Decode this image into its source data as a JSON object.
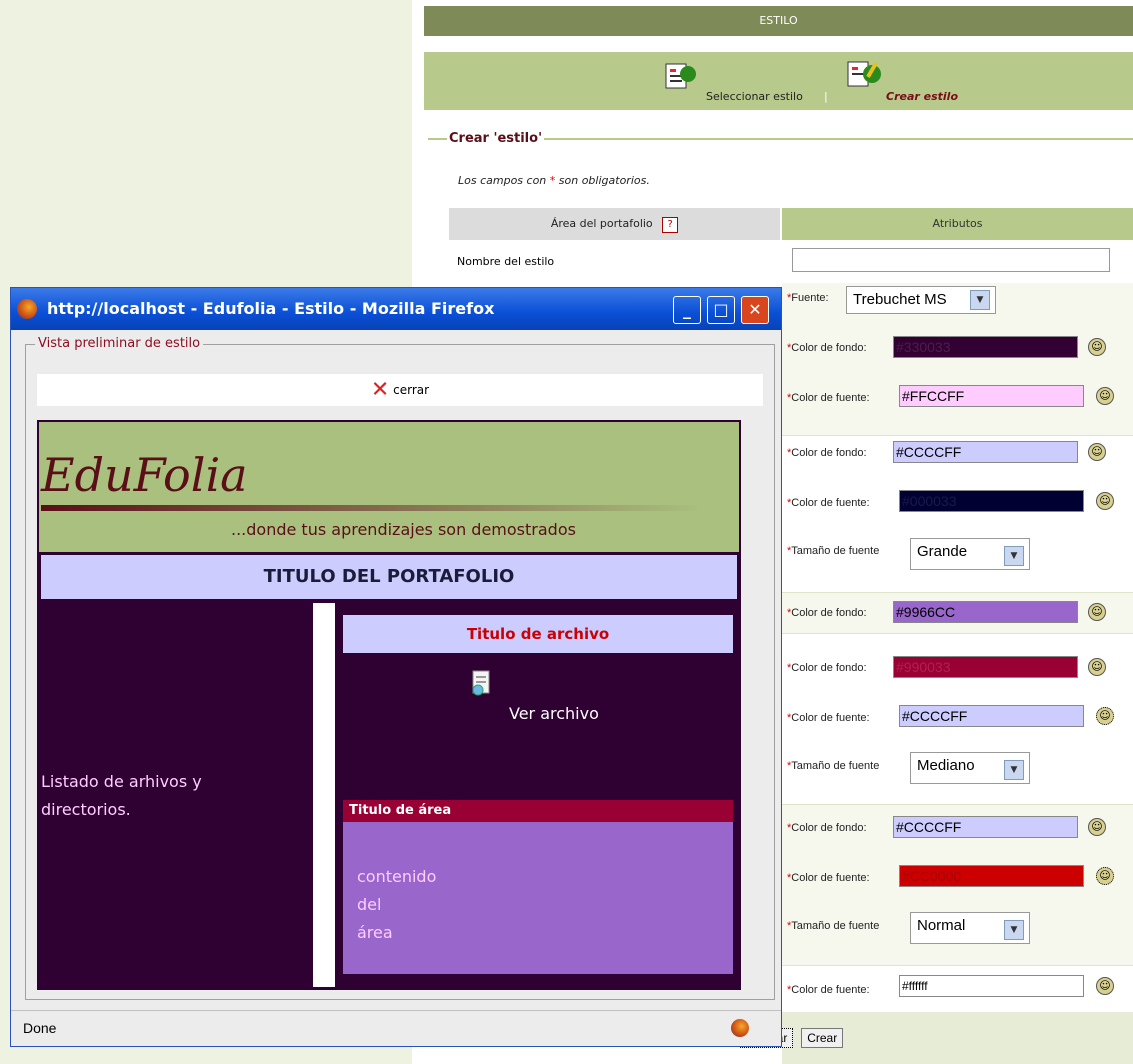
{
  "header": {
    "title": "ESTILO"
  },
  "nav": {
    "select_label": "Seleccionar estilo",
    "separator": "|",
    "create_label": "Crear estilo"
  },
  "form": {
    "legend": "Crear 'estilo'",
    "required_prefix": "Los campos con ",
    "required_star": "*",
    "required_suffix": " son obligatorios.",
    "col_area": "Área del portafolio",
    "col_attr": "Atributos",
    "name_label": "Nombre del estilo",
    "name_value": ""
  },
  "attributes": {
    "font_label": "Fuente:",
    "font_value": "Trebuchet MS",
    "bg_label": "Color de fondo:",
    "fg_label": "Color de fuente:",
    "size_label": "Tamaño de fuente",
    "bg1": "#330033",
    "fg1": "#FFCCFF",
    "bg2": "#CCCCFF",
    "fg2": "#000033",
    "size2": "Grande",
    "bg3": "#9966CC",
    "bg4": "#990033",
    "fg4": "#CCCCFF",
    "size4": "Mediano",
    "bg5": "#CCCCFF",
    "fg5": "#CC0000",
    "size5": "Normal",
    "fg6": "#ffffff"
  },
  "buttons": {
    "preview": "sualizar",
    "create": "Crear"
  },
  "popup": {
    "title": "http://localhost - Edufolia - Estilo - Mozilla Firefox",
    "legend": "Vista preliminar de estilo",
    "close": "cerrar",
    "brand": "EduFolia",
    "tagline": "...donde tus aprendizajes son demostrados",
    "portfolio_title": "TITULO DEL PORTAFOLIO",
    "list_text_1": "Listado de arhivos y",
    "list_text_2": "directorios.",
    "file_title": "Titulo de archivo",
    "view_file": "Ver archivo",
    "area_title": "Titulo de área",
    "area_content_1": "contenido",
    "area_content_2": "del",
    "area_content_3": "área",
    "status": "Done"
  },
  "colors": {
    "accent_green": "#b7c98b",
    "dark_green": "#7e8a57",
    "window_blue": "#0a4fd6"
  }
}
